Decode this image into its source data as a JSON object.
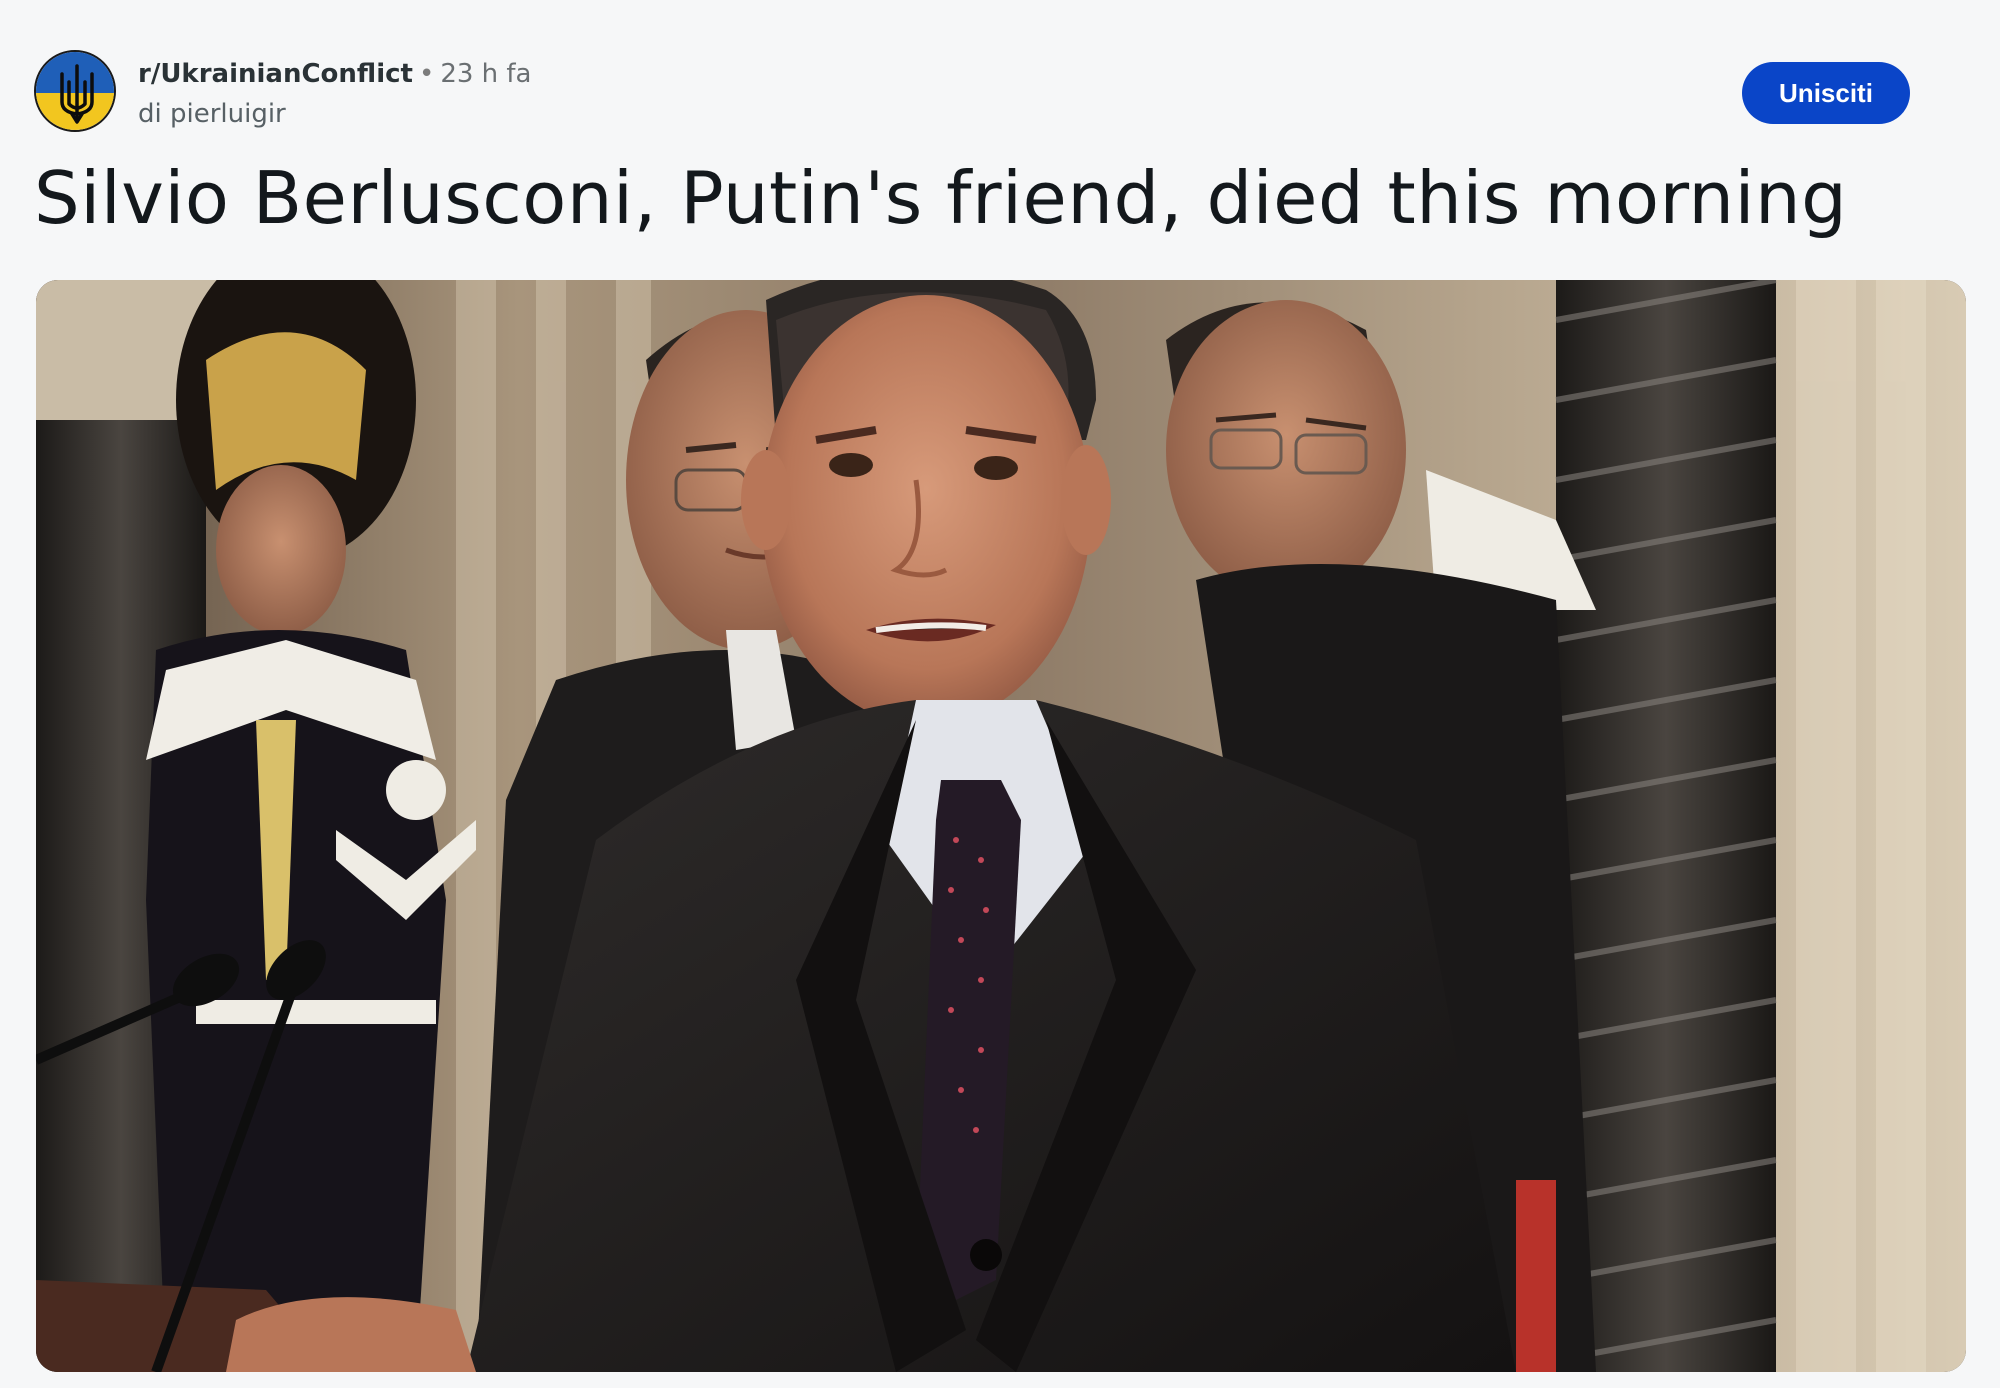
{
  "post": {
    "subreddit": "r/UkrainianConflict",
    "separator": "•",
    "time_ago": "23 h fa",
    "author": "di pierluigir",
    "join_label": "Unisciti",
    "title": "Silvio Berlusconi, Putin's friend, died this morning"
  },
  "colors": {
    "join_button": "#0a45c8",
    "avatar_blue": "#1f5fb8",
    "avatar_yellow": "#f2c61f"
  },
  "icons": {
    "avatar": "ukraine-trident-icon"
  }
}
